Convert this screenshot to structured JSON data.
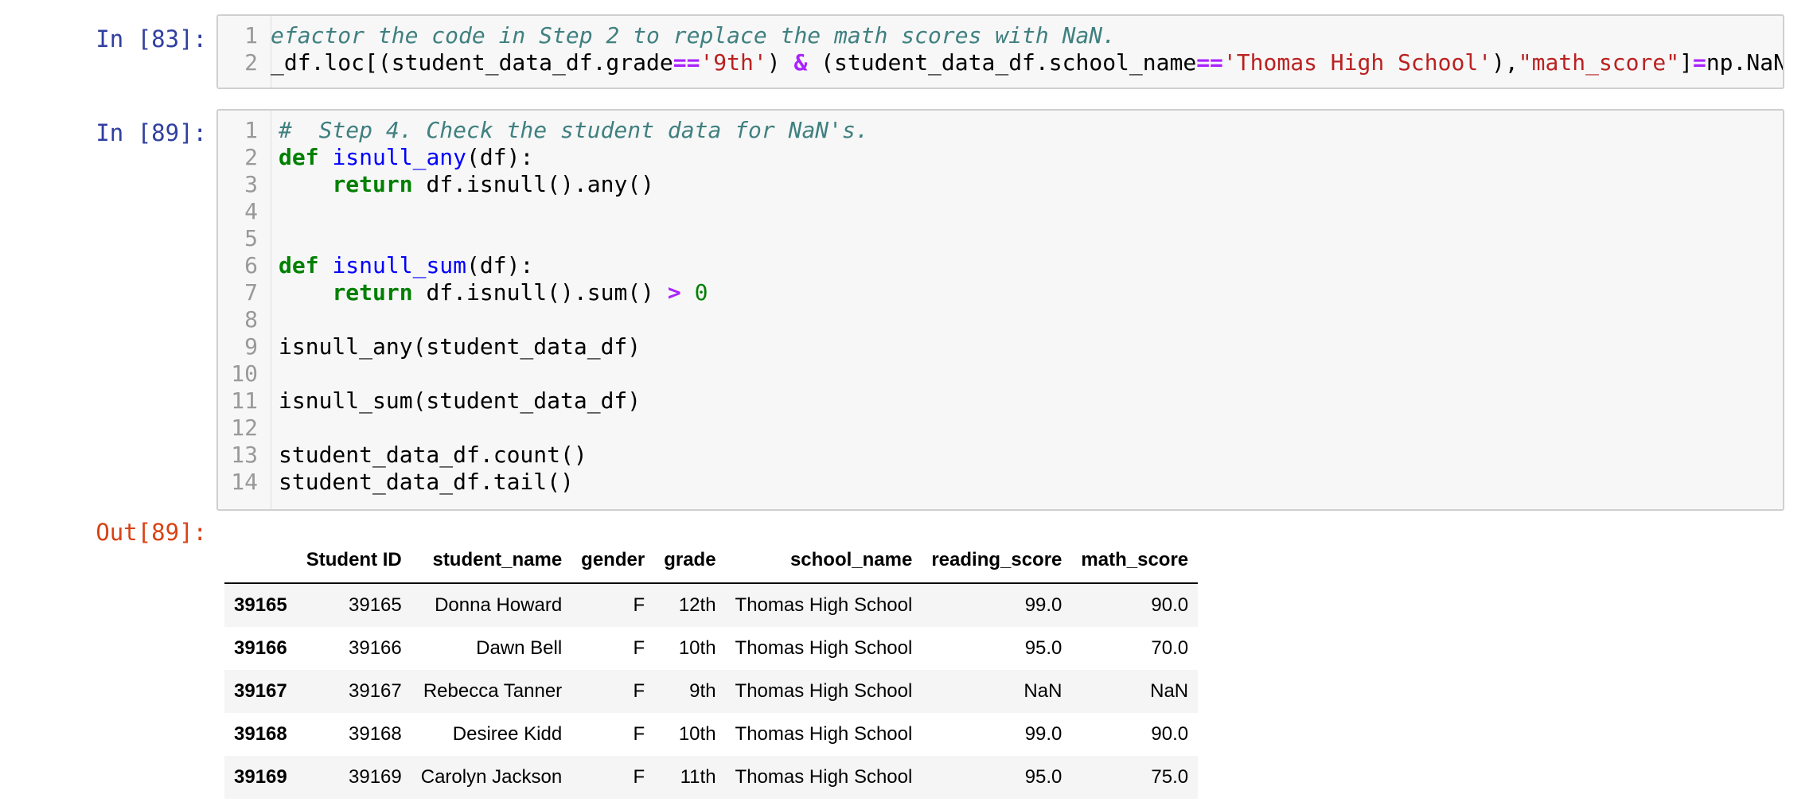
{
  "cells": [
    {
      "prompt": "In [83]:",
      "lines": [
        {
          "n": "1",
          "tokens": [
            {
              "c": "cm",
              "t": "efactor the code in Step 2 to replace the math scores with NaN."
            }
          ]
        },
        {
          "n": "2",
          "tokens": [
            {
              "c": "",
              "t": "_df.loc[(student_data_df.grade"
            },
            {
              "c": "op",
              "t": "=="
            },
            {
              "c": "str",
              "t": "'9th'"
            },
            {
              "c": "",
              "t": ") "
            },
            {
              "c": "op",
              "t": "&"
            },
            {
              "c": "",
              "t": " (student_data_df.school_name"
            },
            {
              "c": "op",
              "t": "=="
            },
            {
              "c": "str",
              "t": "'Thomas High School'"
            },
            {
              "c": "",
              "t": "),"
            },
            {
              "c": "str",
              "t": "\"math_score\""
            },
            {
              "c": "",
              "t": "]"
            },
            {
              "c": "op",
              "t": "="
            },
            {
              "c": "",
              "t": "np.NaN"
            }
          ]
        }
      ]
    },
    {
      "prompt": "In [89]:",
      "lines": [
        {
          "n": "1",
          "tokens": [
            {
              "c": "cm",
              "t": "#  Step 4. Check the student data for NaN's."
            }
          ]
        },
        {
          "n": "2",
          "tokens": [
            {
              "c": "kw",
              "t": "def"
            },
            {
              "c": "",
              "t": " "
            },
            {
              "c": "fn",
              "t": "isnull_any"
            },
            {
              "c": "",
              "t": "(df):"
            }
          ]
        },
        {
          "n": "3",
          "tokens": [
            {
              "c": "",
              "t": "    "
            },
            {
              "c": "kw",
              "t": "return"
            },
            {
              "c": "",
              "t": " df.isnull().any()"
            }
          ]
        },
        {
          "n": "4",
          "tokens": []
        },
        {
          "n": "5",
          "tokens": []
        },
        {
          "n": "6",
          "tokens": [
            {
              "c": "kw",
              "t": "def"
            },
            {
              "c": "",
              "t": " "
            },
            {
              "c": "fn",
              "t": "isnull_sum"
            },
            {
              "c": "",
              "t": "(df):"
            }
          ]
        },
        {
          "n": "7",
          "tokens": [
            {
              "c": "",
              "t": "    "
            },
            {
              "c": "kw",
              "t": "return"
            },
            {
              "c": "",
              "t": " df.isnull().sum() "
            },
            {
              "c": "op",
              "t": ">"
            },
            {
              "c": "",
              "t": " "
            },
            {
              "c": "num",
              "t": "0"
            }
          ]
        },
        {
          "n": "8",
          "tokens": []
        },
        {
          "n": "9",
          "tokens": [
            {
              "c": "",
              "t": "isnull_any(student_data_df)"
            }
          ]
        },
        {
          "n": "10",
          "tokens": []
        },
        {
          "n": "11",
          "tokens": [
            {
              "c": "",
              "t": "isnull_sum(student_data_df)"
            }
          ]
        },
        {
          "n": "12",
          "tokens": []
        },
        {
          "n": "13",
          "tokens": [
            {
              "c": "",
              "t": "student_data_df.count()"
            }
          ]
        },
        {
          "n": "14",
          "tokens": [
            {
              "c": "",
              "t": "student_data_df.tail()"
            }
          ]
        }
      ]
    }
  ],
  "output": {
    "prompt": "Out[89]:",
    "columns": [
      "",
      "Student ID",
      "student_name",
      "gender",
      "grade",
      "school_name",
      "reading_score",
      "math_score"
    ],
    "rows": [
      [
        "39165",
        "39165",
        "Donna Howard",
        "F",
        "12th",
        "Thomas High School",
        "99.0",
        "90.0"
      ],
      [
        "39166",
        "39166",
        "Dawn Bell",
        "F",
        "10th",
        "Thomas High School",
        "95.0",
        "70.0"
      ],
      [
        "39167",
        "39167",
        "Rebecca Tanner",
        "F",
        "9th",
        "Thomas High School",
        "NaN",
        "NaN"
      ],
      [
        "39168",
        "39168",
        "Desiree Kidd",
        "F",
        "10th",
        "Thomas High School",
        "99.0",
        "90.0"
      ],
      [
        "39169",
        "39169",
        "Carolyn Jackson",
        "F",
        "11th",
        "Thomas High School",
        "95.0",
        "75.0"
      ]
    ]
  }
}
